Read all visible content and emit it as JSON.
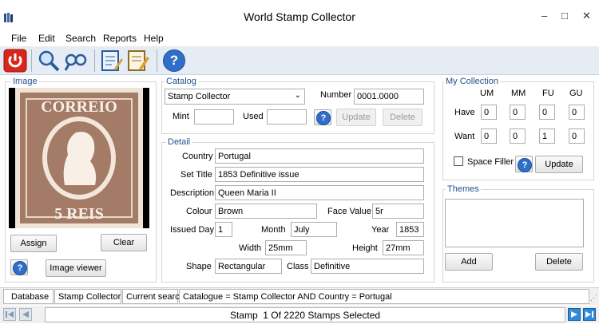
{
  "window": {
    "title": "World Stamp Collector",
    "minimize": "–",
    "maximize": "□",
    "close": "✕"
  },
  "menu": [
    "File",
    "Edit",
    "Search",
    "Reports",
    "Help"
  ],
  "toolbar": {
    "icons": [
      "power-icon",
      "search-icon",
      "find-binoculars-icon",
      "edit-notes-icon",
      "edit-pencil-icon",
      "help-icon"
    ],
    "help_glyph": "?"
  },
  "image_panel": {
    "label": "Image",
    "stamp": {
      "top_text": "CORREIO",
      "bottom_text": "5 REIS"
    },
    "assign": "Assign",
    "clear": "Clear",
    "help_glyph": "?",
    "image_viewer": "Image viewer"
  },
  "catalog": {
    "label": "Catalog",
    "catalogue": "Stamp Collector",
    "number_label": "Number",
    "number": "0001.0000",
    "mint_label": "Mint",
    "mint": "",
    "used_label": "Used",
    "used": "",
    "help_glyph": "?",
    "update": "Update",
    "delete": "Delete"
  },
  "detail": {
    "label": "Detail",
    "country_label": "Country",
    "country": "Portugal",
    "set_title_label": "Set Title",
    "set_title": "1853 Definitive issue",
    "description_label": "Description",
    "description": "Queen Maria II",
    "colour_label": "Colour",
    "colour": "Brown",
    "face_value_label": "Face Value",
    "face_value": "5r",
    "issued_day_label": "Issued Day",
    "issued_day": "1",
    "month_label": "Month",
    "month": "July",
    "year_label": "Year",
    "year": "1853",
    "width_label": "Width",
    "width": "25mm",
    "height_label": "Height",
    "height": "27mm",
    "shape_label": "Shape",
    "shape": "Rectangular",
    "class_label": "Class",
    "class": "Definitive"
  },
  "collection": {
    "label": "My Collection",
    "headers": [
      "UM",
      "MM",
      "FU",
      "GU"
    ],
    "have_label": "Have",
    "have": [
      "0",
      "0",
      "0",
      "0"
    ],
    "want_label": "Want",
    "want": [
      "0",
      "0",
      "1",
      "0"
    ],
    "space_filler_label": "Space Filler",
    "space_filler_checked": false,
    "help_glyph": "?",
    "update": "Update"
  },
  "themes": {
    "label": "Themes",
    "add": "Add",
    "delete": "Delete"
  },
  "status": {
    "database": "Database",
    "collection": "Stamp Collector",
    "current_search": "Current search",
    "query": "Catalogue = Stamp Collector AND Country = Portugal"
  },
  "navigation": {
    "record_text": "Stamp  1 Of 2220 Stamps Selected"
  },
  "colors": {
    "accent": "#2f6fc9",
    "group_label": "#1f4f8e",
    "stamp_brown": "#a37b67",
    "power_red": "#d9261c"
  }
}
